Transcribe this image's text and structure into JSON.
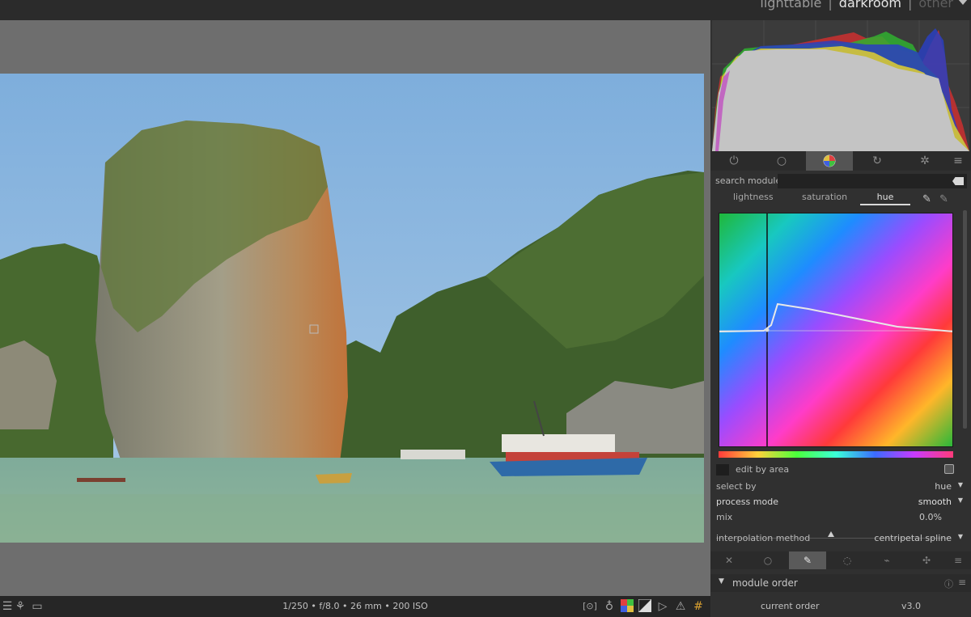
{
  "views": {
    "lighttable": "lighttable",
    "darkroom": "darkroom",
    "other": "other",
    "separator": "|"
  },
  "bottom_bar": {
    "exif": "1/250 • f/8.0 • 26 mm • 200 ISO",
    "left_icons": [
      "list-icon",
      "graph-icon",
      "monitor-icon"
    ],
    "right_icons": [
      "focus-peaking-icon",
      "bulb-icon",
      "color-assessment-icon",
      "over-exposure-icon",
      "softproof-icon",
      "gamut-warning-icon",
      "grid-guides-icon"
    ]
  },
  "module_groups": {
    "tabs": [
      "power-icon",
      "circle-icon",
      "color-wheel-icon",
      "swirl-icon",
      "aperture-icon",
      "menu-icon"
    ],
    "active_index": 2
  },
  "search": {
    "label": "search module",
    "placeholder": ""
  },
  "color_zones": {
    "tabs": [
      "lightness",
      "saturation",
      "hue"
    ],
    "active_tab": "hue"
  },
  "controls": {
    "edit_by_area": "edit by area",
    "select_by_label": "select by",
    "select_by_value": "hue",
    "process_mode_label": "process mode",
    "process_mode_value": "smooth",
    "mix_label": "mix",
    "mix_value": "0.0%",
    "interpolation_label": "interpolation method",
    "interpolation_value": "centripetal spline",
    "dropdown_arrow": "▼"
  },
  "blend_tabs": {
    "tabs": [
      "off-icon",
      "uniform-icon",
      "drawn-mask-icon",
      "parametric-mask-icon",
      "drawn-parametric-icon",
      "raster-mask-icon",
      "menu-icon"
    ],
    "active_index": 2
  },
  "module_order": {
    "title": "module order",
    "current_label": "current order",
    "current_value": "v3.0"
  }
}
